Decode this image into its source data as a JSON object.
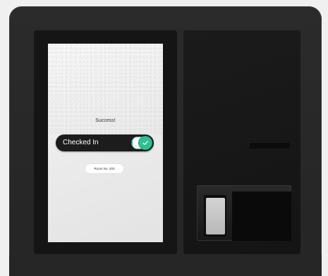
{
  "screen": {
    "status_text": "Success!",
    "toggle": {
      "label": "Checked In",
      "checked": true
    },
    "room_label": "Room No. 203"
  },
  "colors": {
    "accent": "#2db38e",
    "pill": "#1c1c1c",
    "kiosk_body": "#2b2b2b"
  },
  "icons": {
    "check": "check-icon"
  }
}
